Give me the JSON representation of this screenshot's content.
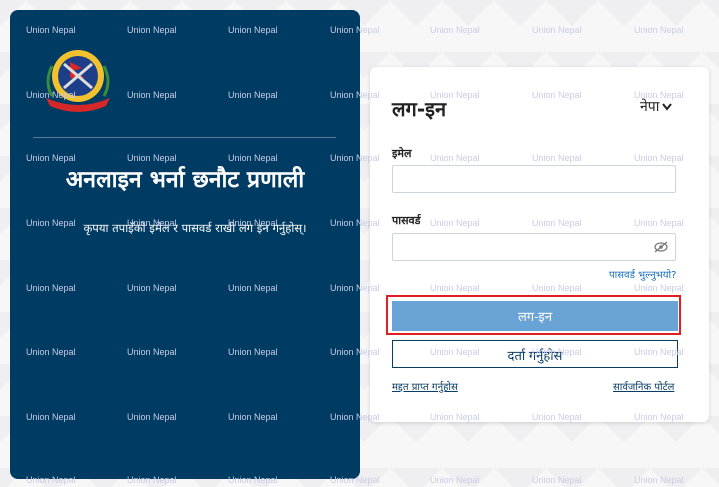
{
  "watermark": {
    "text": "Union Nepal",
    "color": "#c9cde6"
  },
  "left_panel": {
    "logo": "nepal-police-emblem-icon",
    "title": "अनलाइन भर्ना छनौट प्रणाली",
    "subtitle": "कृपया तपाइँको इमेल र पासवर्ड राखी लग इन गर्नुहोस्।",
    "background": "#003b63"
  },
  "login": {
    "title": "लग-इन",
    "language": "नेपा",
    "email_label": "इमेल",
    "email_value": "",
    "password_label": "पासवर्ड",
    "password_value": "",
    "forgot_password": "पासवर्ड भुल्नुभयो?",
    "login_button": "लग-इन",
    "register_button": "दर्ता गर्नुहोस",
    "help_link": "मद्दत प्राप्त गर्नुहोस",
    "public_portal_link": "सार्वजनिक पोर्टल",
    "accent": "#6aa3d5",
    "highlight": "#e02020"
  }
}
